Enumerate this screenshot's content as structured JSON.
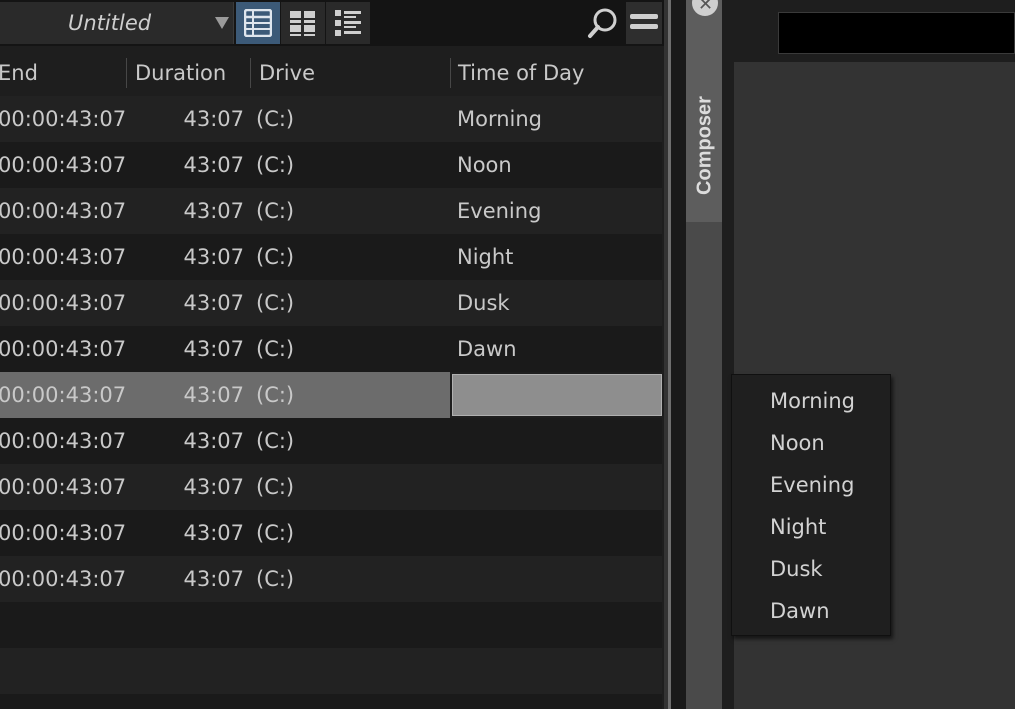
{
  "toolbar": {
    "bin_name": "Untitled"
  },
  "columns": {
    "end": "End",
    "duration": "Duration",
    "drive": "Drive",
    "time_of_day": "Time of Day"
  },
  "rows": [
    {
      "end": "00:00:43:07",
      "duration": "43:07",
      "drive": "(C:)",
      "time_of_day": "Morning"
    },
    {
      "end": "00:00:43:07",
      "duration": "43:07",
      "drive": "(C:)",
      "time_of_day": "Noon"
    },
    {
      "end": "00:00:43:07",
      "duration": "43:07",
      "drive": "(C:)",
      "time_of_day": "Evening"
    },
    {
      "end": "00:00:43:07",
      "duration": "43:07",
      "drive": "(C:)",
      "time_of_day": "Night"
    },
    {
      "end": "00:00:43:07",
      "duration": "43:07",
      "drive": "(C:)",
      "time_of_day": "Dusk"
    },
    {
      "end": "00:00:43:07",
      "duration": "43:07",
      "drive": "(C:)",
      "time_of_day": "Dawn"
    },
    {
      "end": "00:00:43:07",
      "duration": "43:07",
      "drive": "(C:)",
      "time_of_day": ""
    },
    {
      "end": "00:00:43:07",
      "duration": "43:07",
      "drive": "(C:)",
      "time_of_day": ""
    },
    {
      "end": "00:00:43:07",
      "duration": "43:07",
      "drive": "(C:)",
      "time_of_day": ""
    },
    {
      "end": "00:00:43:07",
      "duration": "43:07",
      "drive": "(C:)",
      "time_of_day": ""
    },
    {
      "end": "00:00:43:07",
      "duration": "43:07",
      "drive": "(C:)",
      "time_of_day": ""
    }
  ],
  "composer": {
    "tab_label": "Composer"
  },
  "time_of_day_menu": {
    "items": [
      "Morning",
      "Noon",
      "Evening",
      "Night",
      "Dusk",
      "Dawn"
    ]
  },
  "icons": {
    "view_text": "text-view-icon",
    "view_frame": "frame-view-icon",
    "view_script": "script-view-icon",
    "search": "search-icon",
    "menu": "hamburger-menu-icon",
    "close": "close-icon"
  },
  "colors": {
    "active_view": "#3c5a78",
    "selected_row": "#6c6c6c",
    "edit_field": "#8e8e8e"
  }
}
